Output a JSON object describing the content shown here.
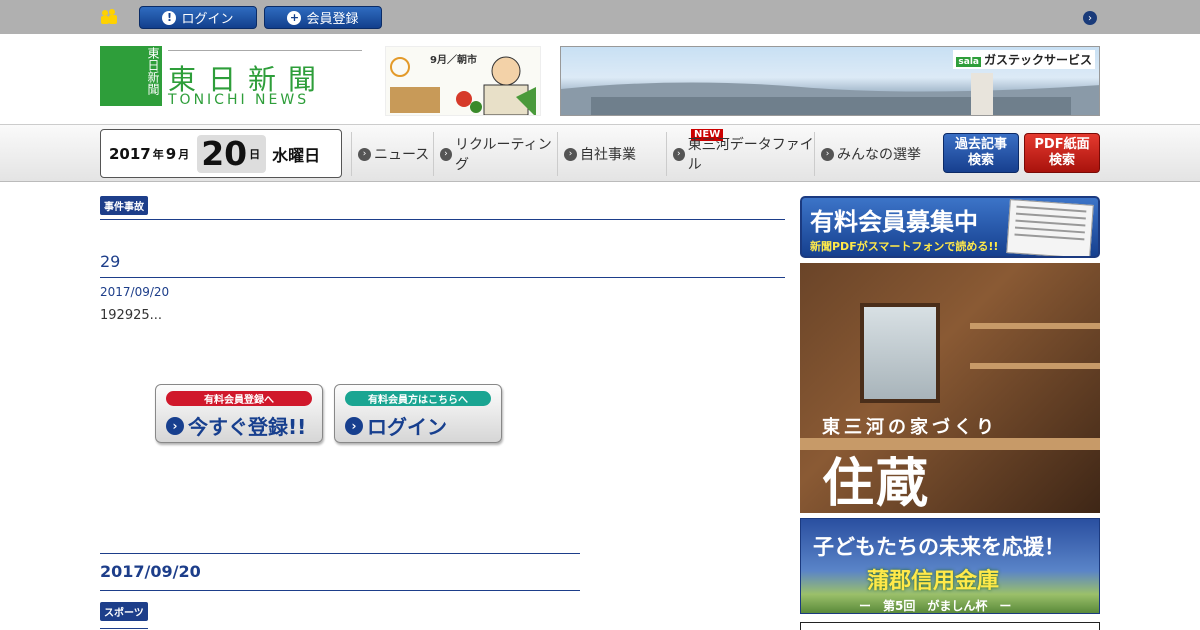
{
  "topbar": {
    "login_label": "ログイン",
    "register_label": "会員登録"
  },
  "header": {
    "logo_vertical": "東日新聞",
    "logo_title": "東日新聞",
    "logo_subtitle": "TONICHI NEWS",
    "ad_asaichi_caption": "9月／朝市",
    "ad_gas_brand": "ガステックサービス",
    "ad_gas_brand_prefix": "sala"
  },
  "date": {
    "year": "2017",
    "year_unit": "年",
    "month": "9",
    "month_unit": "月",
    "day": "20",
    "day_unit": "日",
    "weekday": "水曜日"
  },
  "nav": {
    "items": [
      {
        "label": "ニュース"
      },
      {
        "label": "リクルーティング"
      },
      {
        "label": "自社事業"
      },
      {
        "label": "東三河データファイル",
        "badge": "NEW"
      },
      {
        "label": "みんなの選挙"
      }
    ],
    "archive_button": [
      "過去記事",
      "検索"
    ],
    "pdf_button": [
      "PDF紙面",
      "検索"
    ]
  },
  "article": {
    "category": "事件事故",
    "title": "29",
    "date": "2017/09/20",
    "excerpt": "192925..."
  },
  "cta": {
    "register": {
      "pill": "有料会員登録へ",
      "label": "今すぐ登録!!"
    },
    "login": {
      "pill": "有料会員方はこちらへ",
      "label": "ログイン"
    }
  },
  "list": {
    "date": "2017/09/20",
    "category": "スポーツ"
  },
  "sidebar": {
    "recruit": {
      "head": "有料会員募集中",
      "sub": "新聞PDFがスマートフォンで読める!!"
    },
    "house": {
      "tag": "東三河の家づくり",
      "brand": "住蔵"
    },
    "bank": {
      "line1": "子どもたちの未来を応援！",
      "line2": "蒲郡信用金庫",
      "line3": "ー　第5回　がましん杯　ー"
    }
  },
  "colors": {
    "brand_green": "#2e9e3a",
    "navy": "#1d3e8a",
    "red": "#cc0000"
  }
}
